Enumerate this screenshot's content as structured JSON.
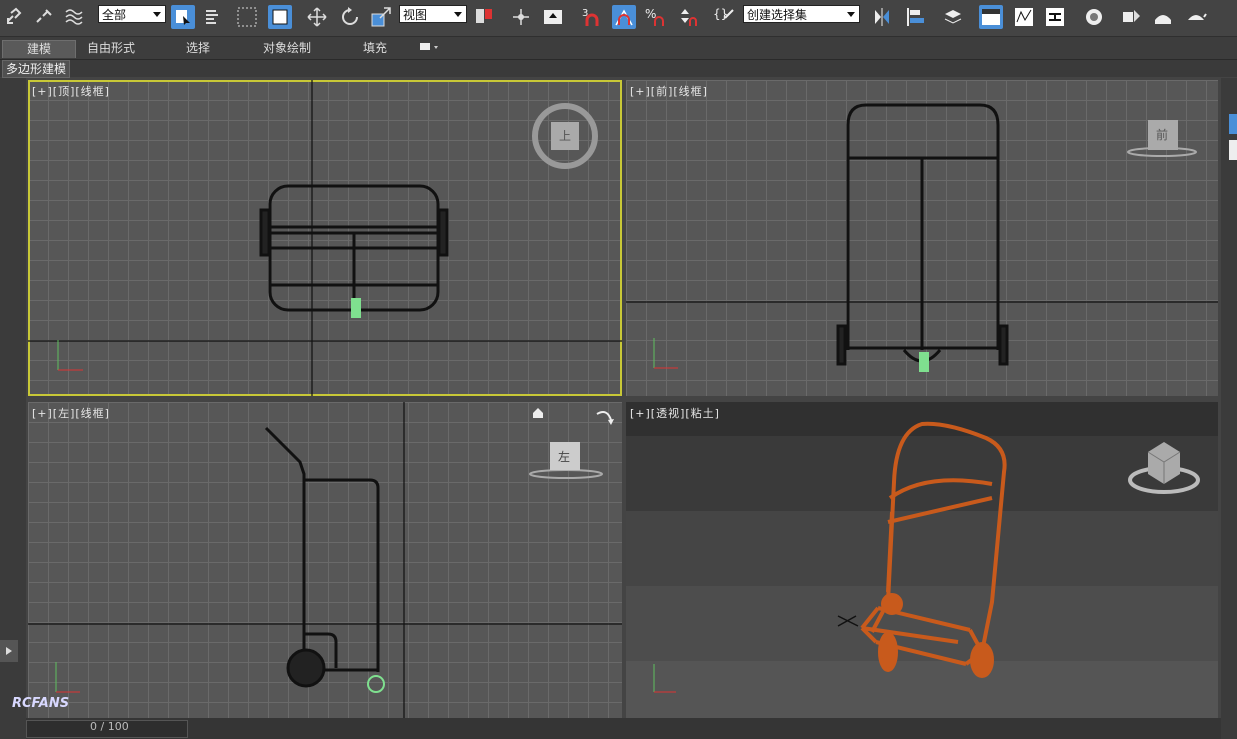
{
  "toolbar": {
    "filter_dropdown": "全部",
    "coord_dropdown": "视图",
    "snap_label": "3",
    "selection_set_dropdown": "创建选择集"
  },
  "ribbon": {
    "tabs": [
      "建模",
      "自由形式",
      "选择",
      "对象绘制",
      "填充"
    ]
  },
  "subbar": {
    "label": "多边形建模"
  },
  "viewports": {
    "top": {
      "label": "[+][顶][线框]",
      "cube_label": "上"
    },
    "front": {
      "label": "[+][前][线框]",
      "cube_label": "前"
    },
    "left": {
      "label": "[+][左][线框]",
      "cube_label": "左"
    },
    "perspective": {
      "label": "[+][透视][粘土]"
    }
  },
  "status": {
    "time": "0 / 100",
    "logo": "RCFANS"
  },
  "colors": {
    "active_border": "#c8c837",
    "accent": "#4a8fd8",
    "model_perspective": "#c85a1c"
  }
}
